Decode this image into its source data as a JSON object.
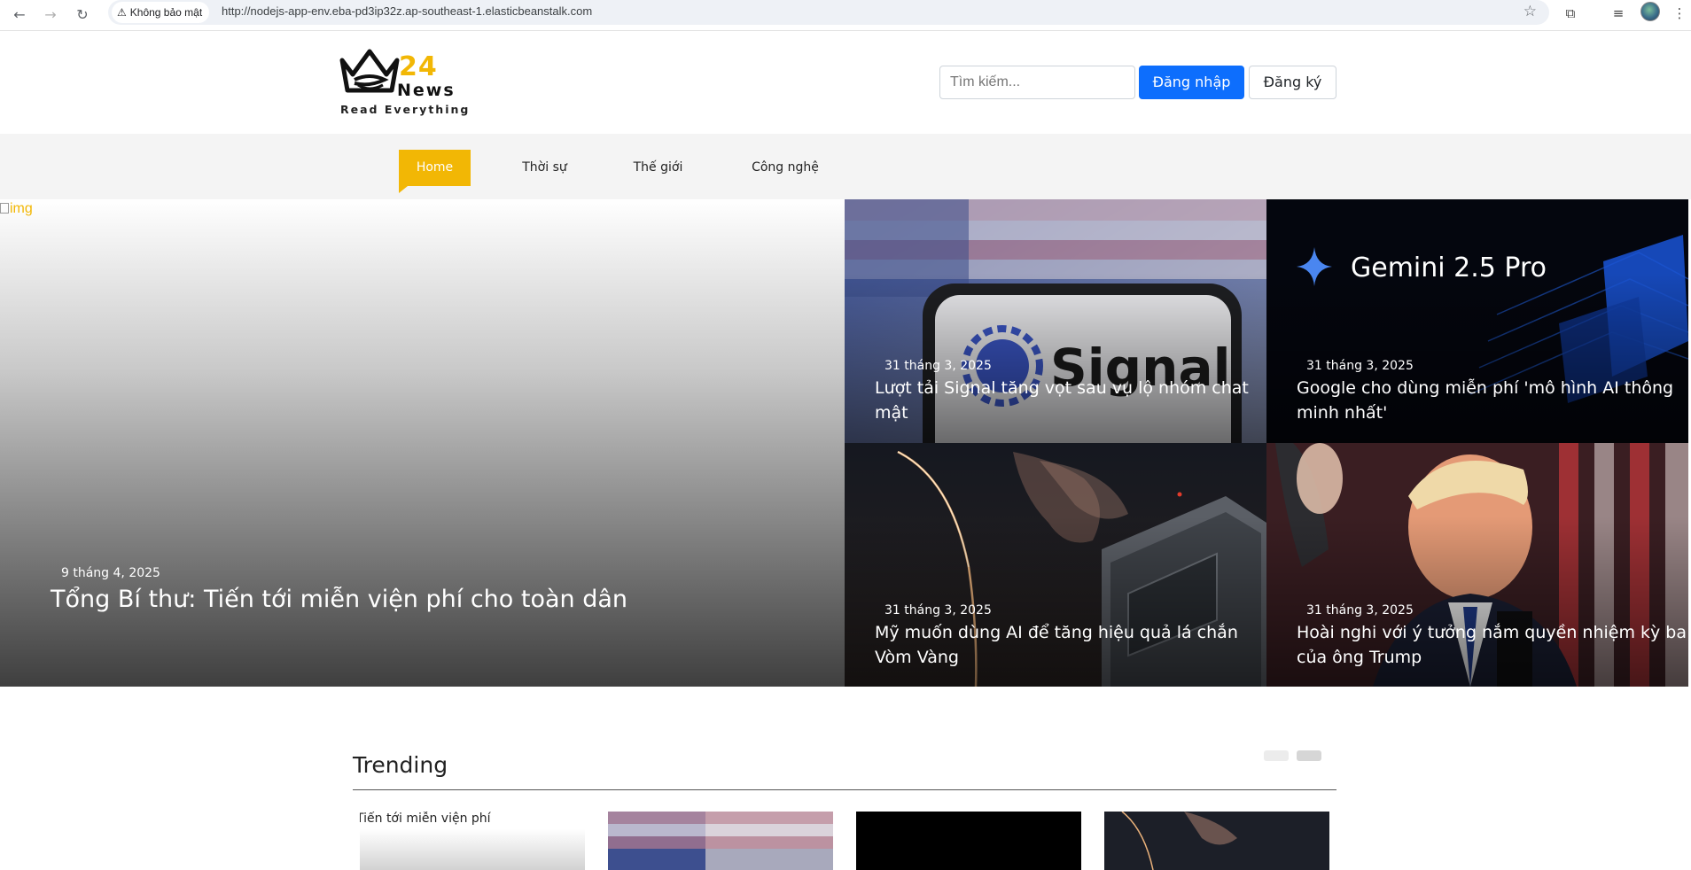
{
  "browser": {
    "security_label": "Không bảo mật",
    "url": "http://nodejs-app-env.eba-pd3ip32z.ap-southeast-1.elasticbeanstalk.com"
  },
  "site": {
    "logo_number": "24",
    "logo_word": "News",
    "logo_tagline": "Read Everything",
    "search_placeholder": "Tìm kiếm...",
    "login_label": "Đăng nhập",
    "register_label": "Đăng ký",
    "brand_color": "#f2b705",
    "primary_color": "#0d6efd"
  },
  "nav": {
    "items": [
      {
        "label": "Home",
        "active": true
      },
      {
        "label": "Thời sự",
        "active": false
      },
      {
        "label": "Thế giới",
        "active": false
      },
      {
        "label": "Công nghệ",
        "active": false
      }
    ]
  },
  "hero": {
    "main": {
      "img_alt": "img",
      "date": "9 tháng 4, 2025",
      "title": "Tổng Bí thư: Tiến tới miễn viện phí cho toàn dân"
    },
    "tiles": [
      {
        "date": "31 tháng 3, 2025",
        "title": "Lượt tải Signal tăng vọt sau vụ lộ nhóm chat mật",
        "image": "signal-phone-photo"
      },
      {
        "date": "31 tháng 3, 2025",
        "title": "Google cho dùng miễn phí 'mô hình AI thông minh nhất'",
        "image": "gemini-banner",
        "image_text": "Gemini 2.5 Pro"
      },
      {
        "date": "31 tháng 3, 2025",
        "title": "Mỹ muốn dùng AI để tăng hiệu quả lá chắn Vòm Vàng",
        "image": "missile-defense-photo"
      },
      {
        "date": "31 tháng 3, 2025",
        "title": "Hoài nghi với ý tưởng nắm quyền nhiệm kỳ ba của ông Trump",
        "image": "trump-portrait-photo"
      }
    ]
  },
  "trending": {
    "title": "Trending",
    "first_card_text": "Tiến tới miễn viện phí"
  }
}
